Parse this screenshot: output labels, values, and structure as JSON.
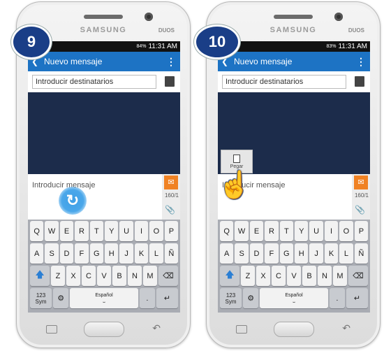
{
  "device": {
    "brand": "SAMSUNG",
    "variant": "DUOS"
  },
  "panels": [
    {
      "step": "9",
      "status": {
        "battery": "84%",
        "time": "11:31 AM"
      },
      "app_bar": {
        "title": "Nuevo mensaje"
      },
      "recipient": {
        "placeholder": "Introducir destinatarios"
      },
      "compose": {
        "placeholder": "Introducir mensaje",
        "counter": "160/1"
      }
    },
    {
      "step": "10",
      "status": {
        "battery": "83%",
        "time": "11:31 AM"
      },
      "app_bar": {
        "title": "Nuevo mensaje"
      },
      "recipient": {
        "placeholder": "Introducir destinatarios"
      },
      "compose": {
        "placeholder": "Introducir mensaje",
        "counter": "160/1"
      },
      "popup": {
        "label": "Pegar"
      }
    }
  ],
  "keyboard": {
    "row1": [
      "Q",
      "W",
      "E",
      "R",
      "T",
      "Y",
      "U",
      "I",
      "O",
      "P"
    ],
    "row2": [
      "A",
      "S",
      "D",
      "F",
      "G",
      "H",
      "J",
      "K",
      "L",
      "Ñ"
    ],
    "row3": [
      "Z",
      "X",
      "C",
      "V",
      "B",
      "N",
      "M"
    ],
    "sym_top": "123",
    "sym_bottom": "Sym",
    "space_label": "Español"
  },
  "colors": {
    "app_bar": "#1d73c4",
    "badge": "#1a3e87",
    "send_button": "#f08224"
  }
}
